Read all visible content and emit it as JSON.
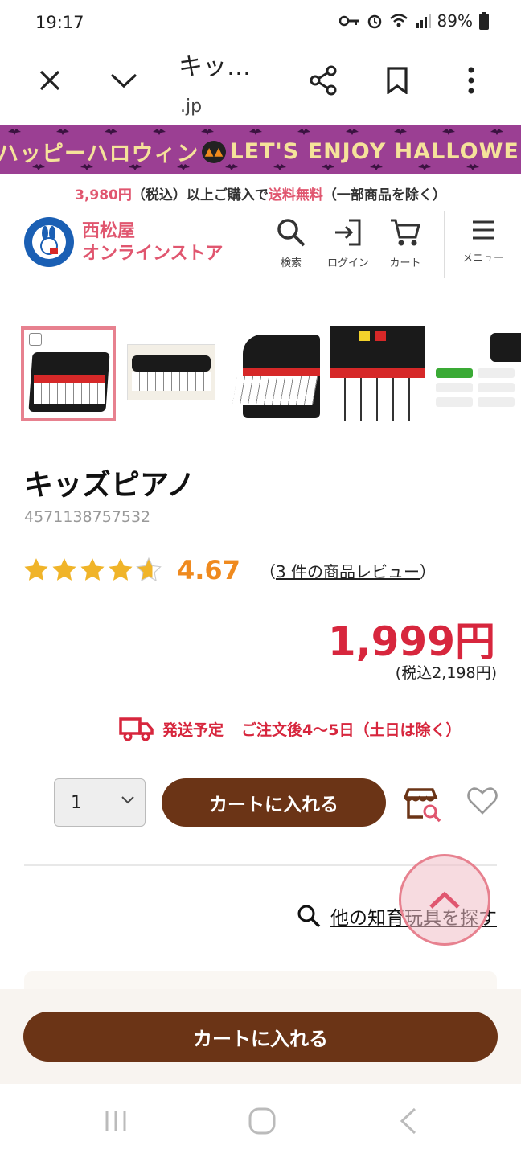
{
  "status_bar": {
    "time": "19:17",
    "battery": "89%",
    "icons": [
      "key-icon",
      "alarm-icon",
      "wifi-icon",
      "signal-icon",
      "battery-icon"
    ]
  },
  "browser": {
    "title": "キッ…",
    "url": ".jp",
    "buttons": [
      "close-icon",
      "chevron-down-icon",
      "share-icon",
      "bookmark-icon",
      "more-icon"
    ]
  },
  "banner": {
    "text_left": "ハッピーハロウィン",
    "text_right": "LET'S ENJOY HALLOWEEN PARTY"
  },
  "shipping_note": {
    "amount": "3,980円",
    "middle": "（税込）以上ご購入で",
    "free": "送料無料",
    "tail": "（一部商品を除く）"
  },
  "header": {
    "logo_line1": "西松屋",
    "logo_line2": "オンラインストア",
    "search_label": "検索",
    "login_label": "ログイン",
    "cart_label": "カート",
    "menu_label": "メニュー"
  },
  "product": {
    "title": "キッズピアノ",
    "code": "4571138757532",
    "rating_value": 4.67,
    "rating_text": "4.67",
    "review_prefix": "（",
    "review_link": "3 件の商品レビュー",
    "review_suffix": "）",
    "price": "1,999円",
    "price_tax": "(税込2,198円)",
    "delivery_label": "発送予定",
    "delivery_text": "ご注文後4〜5日（土日は除く）",
    "quantity": "1",
    "add_to_cart": "カートに入れる",
    "search_other": "他の知育玩具を探す"
  },
  "bottom": {
    "add_to_cart": "カートに入れる"
  },
  "colors": {
    "brand_brown": "#6b3416",
    "price_red": "#d7263d",
    "accent_pink": "#e0566f",
    "star_gold": "#f0b429",
    "banner_purple": "#9b3f93"
  }
}
